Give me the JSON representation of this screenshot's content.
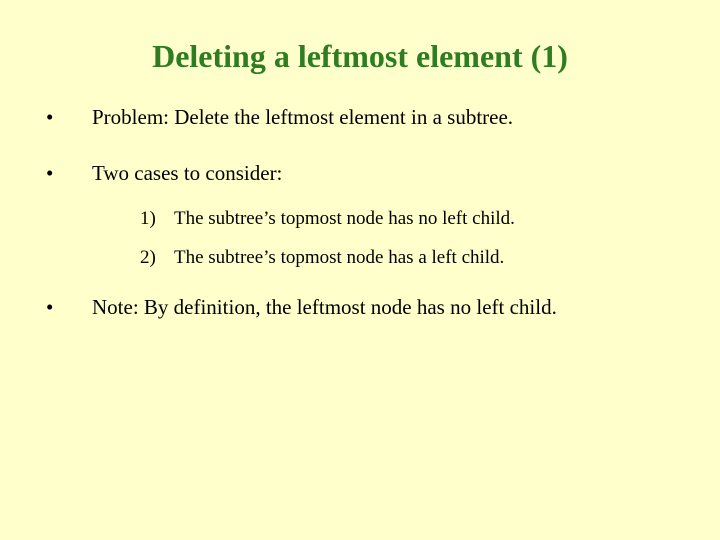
{
  "title": "Deleting a leftmost element (1)",
  "bullets": {
    "b1": {
      "marker": "•",
      "text": "Problem: Delete the leftmost element in a subtree."
    },
    "b2": {
      "marker": "•",
      "text": "Two cases to consider:"
    },
    "b3": {
      "marker": "•",
      "text": "Note: By definition, the leftmost node has no left child."
    }
  },
  "subitems": {
    "s1": {
      "num": "1)",
      "text": "The subtree’s topmost node has no left child."
    },
    "s2": {
      "num": "2)",
      "text": "The subtree’s topmost node has a left child."
    }
  }
}
